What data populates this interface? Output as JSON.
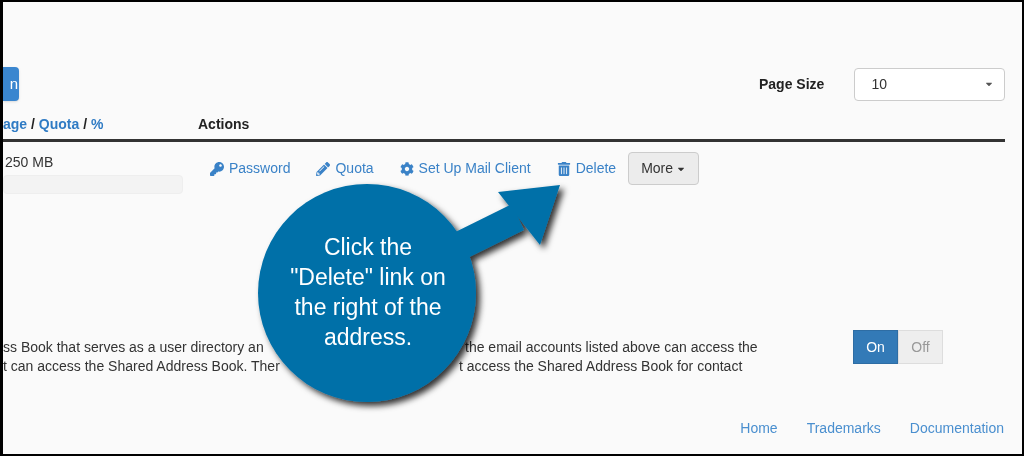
{
  "top_button": {
    "label": "n"
  },
  "page_size": {
    "label": "Page Size",
    "value": "10"
  },
  "table": {
    "columns": [
      {
        "parts": [
          {
            "text": "age",
            "kind": "link"
          },
          {
            "text": " / ",
            "kind": "plain"
          },
          {
            "text": "Quota",
            "kind": "link"
          },
          {
            "text": " / ",
            "kind": "plain"
          },
          {
            "text": "%",
            "kind": "link"
          }
        ]
      },
      {
        "parts": [
          {
            "text": "Actions",
            "kind": "plain"
          }
        ]
      }
    ],
    "rows": [
      {
        "usage": "250 MB",
        "actions": [
          {
            "label": "Password"
          },
          {
            "label": "Quota"
          },
          {
            "label": "Set Up Mail Client"
          },
          {
            "label": "Delete"
          }
        ],
        "more": "More"
      }
    ]
  },
  "shared_address_book": {
    "lines": [
      [
        "ss Book that serves as a user directory an",
        "the email accounts listed above can access the"
      ],
      [
        "t can access the Shared Address Book. Ther",
        "t access the Shared Address Book for contact"
      ]
    ],
    "toggle": [
      {
        "label": "On",
        "selected": true
      },
      {
        "label": "Off",
        "selected": false
      }
    ]
  },
  "callout": {
    "text": "Click the \"Delete\" link on the right of the address."
  },
  "footer": {
    "links": [
      "Home",
      "Trademarks",
      "Documentation"
    ]
  }
}
